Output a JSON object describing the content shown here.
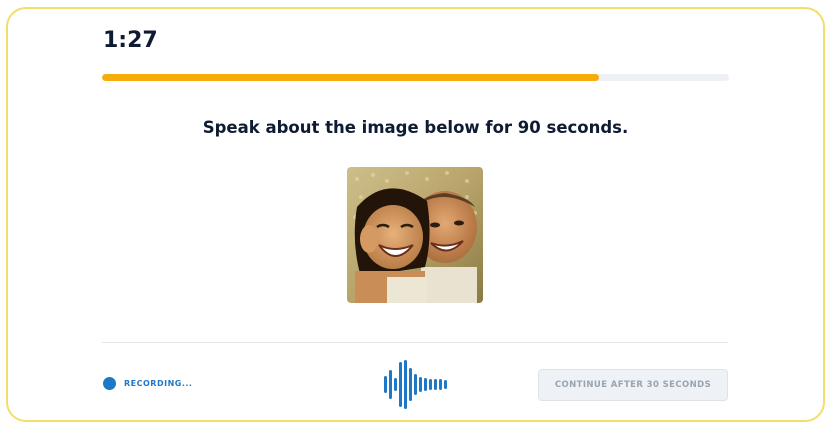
{
  "timer": {
    "text": "1:27"
  },
  "progress": {
    "fraction": 0.793
  },
  "prompt": {
    "text": "Speak about the image below for 90 seconds."
  },
  "photo": {
    "alt": "two-children-laughing-photo"
  },
  "recording": {
    "label": "RECORDING..."
  },
  "actions": {
    "continue_label": "CONTINUE AFTER 30 SECONDS"
  },
  "colors": {
    "accent_progress": "#f6ac0a",
    "recording_blue": "#1f78c7",
    "card_border": "#f3de6b"
  }
}
